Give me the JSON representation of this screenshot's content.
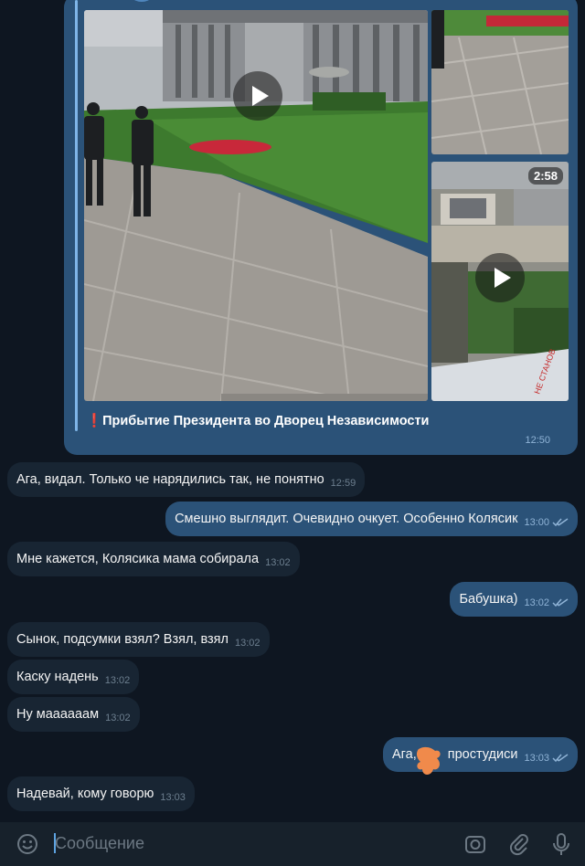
{
  "post": {
    "caption_mark": "❗",
    "caption": "Прибытие Президента во Дворец Независимости",
    "time": "12:50",
    "video_duration": "2:58"
  },
  "messages": [
    {
      "dir": "in",
      "text": "Ага, видал. Только че нарядились так, не понятно",
      "time": "12:59"
    },
    {
      "dir": "out",
      "text": "Смешно выглядит. Очевидно очкует. Особенно Колясик",
      "time": "13:00"
    },
    {
      "dir": "in",
      "text": "Мне кажется, Колясика мама собирала",
      "time": "13:02"
    },
    {
      "dir": "out",
      "text": "Бабушка)",
      "time": "13:02"
    },
    {
      "dir": "in",
      "text": "Сынок, подсумки взял? Взял, взял",
      "time": "13:02"
    },
    {
      "dir": "in",
      "text": "Каску надень",
      "time": "13:02"
    },
    {
      "dir": "in",
      "text": "Ну маааааам",
      "time": "13:02"
    },
    {
      "dir": "out",
      "text_before": "Ага,",
      "text_after": "простудиси",
      "time": "13:03"
    },
    {
      "dir": "in",
      "text": "Надевай, кому говорю",
      "time": "13:03"
    }
  ],
  "composer": {
    "placeholder": "Сообщение"
  },
  "colors": {
    "background": "#0e1621",
    "incoming_bubble": "#182533",
    "outgoing_bubble": "#2b5278",
    "accent": "#5da3e1",
    "redaction_blob": "#f08a4b"
  },
  "icons": [
    "play-icon",
    "double-check-icon",
    "emoji-icon",
    "camera-icon",
    "attach-icon",
    "mic-icon"
  ]
}
